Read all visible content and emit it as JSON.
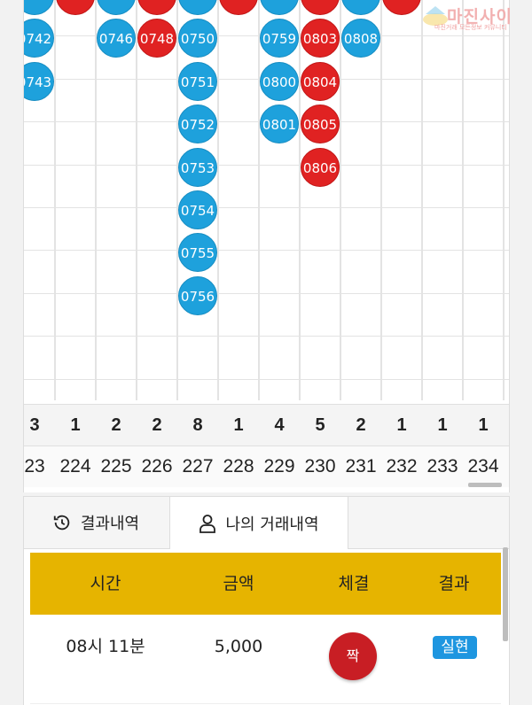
{
  "board": {
    "columns": [
      {
        "count": "3",
        "number": "23",
        "beads": [
          {
            "row": 0,
            "color": "blue",
            "label": ""
          },
          {
            "row": 1,
            "color": "blue",
            "label": "0742"
          },
          {
            "row": 2,
            "color": "blue",
            "label": "0743"
          }
        ]
      },
      {
        "count": "1",
        "number": "224",
        "beads": [
          {
            "row": 0,
            "color": "red",
            "label": ""
          }
        ]
      },
      {
        "count": "2",
        "number": "225",
        "beads": [
          {
            "row": 0,
            "color": "blue",
            "label": ""
          },
          {
            "row": 1,
            "color": "blue",
            "label": "0746"
          }
        ]
      },
      {
        "count": "2",
        "number": "226",
        "beads": [
          {
            "row": 0,
            "color": "red",
            "label": ""
          },
          {
            "row": 1,
            "color": "red",
            "label": "0748"
          }
        ]
      },
      {
        "count": "8",
        "number": "227",
        "beads": [
          {
            "row": 0,
            "color": "blue",
            "label": ""
          },
          {
            "row": 1,
            "color": "blue",
            "label": "0750"
          },
          {
            "row": 2,
            "color": "blue",
            "label": "0751"
          },
          {
            "row": 3,
            "color": "blue",
            "label": "0752"
          },
          {
            "row": 4,
            "color": "blue",
            "label": "0753"
          },
          {
            "row": 5,
            "color": "blue",
            "label": "0754"
          },
          {
            "row": 6,
            "color": "blue",
            "label": "0755"
          },
          {
            "row": 7,
            "color": "blue",
            "label": "0756"
          }
        ]
      },
      {
        "count": "1",
        "number": "228",
        "beads": [
          {
            "row": 0,
            "color": "red",
            "label": ""
          }
        ]
      },
      {
        "count": "4",
        "number": "229",
        "beads": [
          {
            "row": 0,
            "color": "blue",
            "label": ""
          },
          {
            "row": 1,
            "color": "blue",
            "label": "0759"
          },
          {
            "row": 2,
            "color": "blue",
            "label": "0800"
          },
          {
            "row": 3,
            "color": "blue",
            "label": "0801"
          }
        ]
      },
      {
        "count": "5",
        "number": "230",
        "beads": [
          {
            "row": 0,
            "color": "red",
            "label": ""
          },
          {
            "row": 1,
            "color": "red",
            "label": "0803"
          },
          {
            "row": 2,
            "color": "red",
            "label": "0804"
          },
          {
            "row": 3,
            "color": "red",
            "label": "0805"
          },
          {
            "row": 4,
            "color": "red",
            "label": "0806"
          }
        ]
      },
      {
        "count": "2",
        "number": "231",
        "beads": [
          {
            "row": 0,
            "color": "blue",
            "label": ""
          },
          {
            "row": 1,
            "color": "blue",
            "label": "0808"
          }
        ]
      },
      {
        "count": "1",
        "number": "232",
        "beads": [
          {
            "row": 0,
            "color": "red",
            "label": ""
          }
        ]
      },
      {
        "count": "1",
        "number": "233",
        "beads": []
      },
      {
        "count": "1",
        "number": "234",
        "beads": []
      }
    ],
    "colors": {
      "blue": "#1ea1dc",
      "red": "#e02222"
    }
  },
  "watermark": {
    "title": "마진사이",
    "subtitle": "마진거래 모든정보 커뮤니티"
  },
  "tabs": [
    {
      "label": "결과내역",
      "icon": "history-icon",
      "active": false
    },
    {
      "label": "나의 거래내역",
      "icon": "user-icon",
      "active": true
    }
  ],
  "table": {
    "headers": [
      "시간",
      "금액",
      "체결",
      "결과"
    ],
    "header_color": "#e6b400",
    "rows": [
      {
        "time": "08시 11분",
        "amount": "5,000",
        "bet": "짝",
        "result": "실현"
      }
    ]
  }
}
